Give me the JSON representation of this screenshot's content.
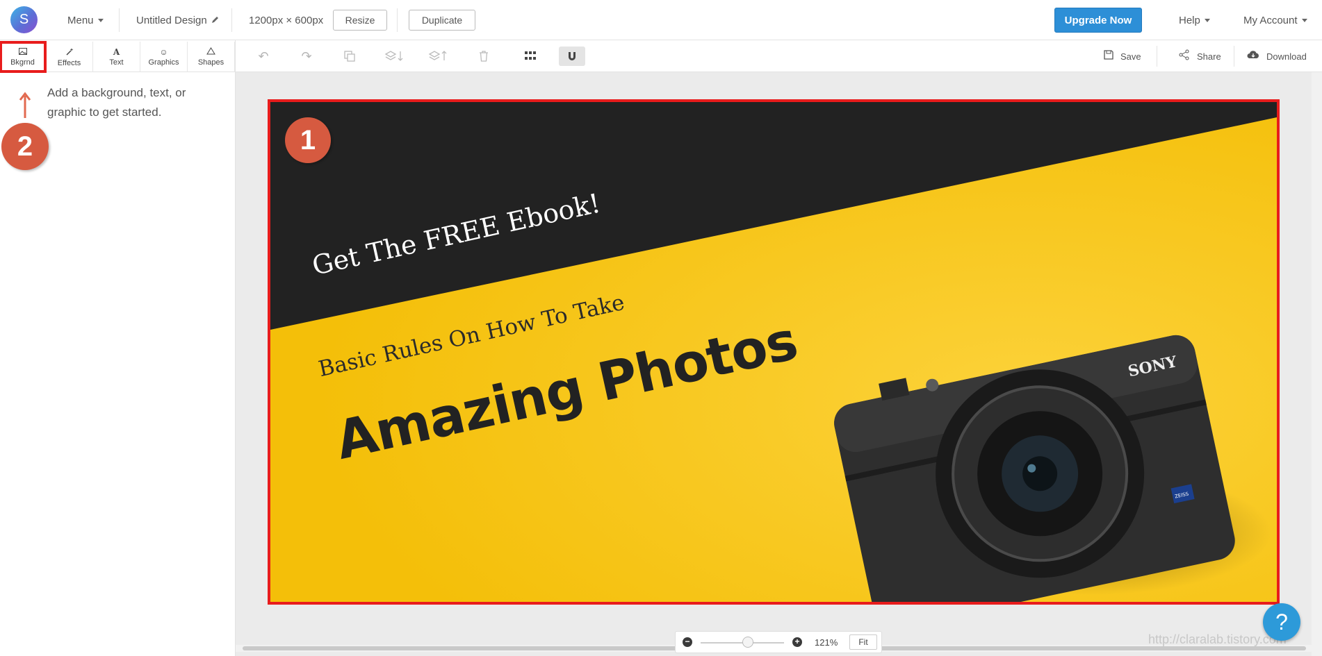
{
  "header": {
    "logo_letter": "S",
    "menu_label": "Menu",
    "design_title": "Untitled Design",
    "dimensions": "1200px × 600px",
    "resize_label": "Resize",
    "duplicate_label": "Duplicate",
    "upgrade_label": "Upgrade Now",
    "help_label": "Help",
    "account_label": "My Account"
  },
  "tabs": [
    {
      "label": "Bkgrnd",
      "icon": "image-icon"
    },
    {
      "label": "Effects",
      "icon": "wand-icon"
    },
    {
      "label": "Text",
      "icon": "text-icon"
    },
    {
      "label": "Graphics",
      "icon": "smiley-icon"
    },
    {
      "label": "Shapes",
      "icon": "triangle-icon"
    }
  ],
  "actions": {
    "save_label": "Save",
    "share_label": "Share",
    "download_label": "Download"
  },
  "panel": {
    "hint": "Add a background, text, or graphic to get started."
  },
  "annotations": {
    "badge1": "1",
    "badge2": "2",
    "color": "#d65a40",
    "highlight_color": "#e81c1c"
  },
  "design": {
    "line1": "Get The FREE Ebook!",
    "line2": "Basic Rules On How To Take",
    "line3": "Amazing Photos",
    "camera_brand": "SONY",
    "lens_brand": "ZEISS",
    "bg_color": "#f6c20c",
    "band_color": "#222222"
  },
  "zoom": {
    "level": "121%",
    "fit_label": "Fit"
  },
  "help_fab": "?",
  "watermark": "http://claralab.tistory.com",
  "colors": {
    "accent": "#2d8fd7"
  }
}
